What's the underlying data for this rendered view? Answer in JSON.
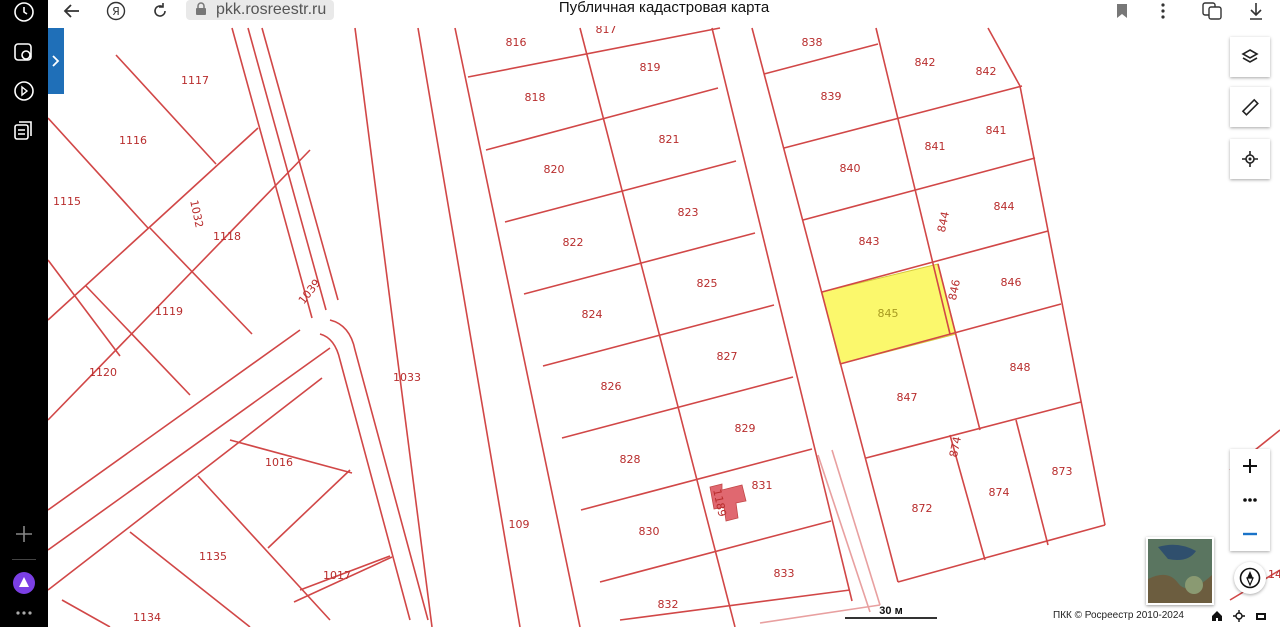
{
  "browser": {
    "url": "pkk.rosreestr.ru",
    "title": "Публичная кадастровая карта"
  },
  "sidebar_left": {
    "icons": [
      "clock-icon",
      "camera-icon",
      "play-icon",
      "collections-icon",
      "plus-icon",
      "alice-icon",
      "more-icon"
    ]
  },
  "map": {
    "highlight_color": "#fbf86c",
    "parcel_color": "#d14747",
    "label_color": "#b82d2d",
    "parcels": {
      "p816": "816",
      "p817": "817",
      "p818": "818",
      "p819": "819",
      "p820": "820",
      "p821": "821",
      "p822": "822",
      "p823": "823",
      "p824": "824",
      "p825": "825",
      "p826": "826",
      "p827": "827",
      "p828": "828",
      "p829": "829",
      "p830": "830",
      "p831": "831",
      "p832": "832",
      "p833": "833",
      "p838": "838",
      "p839": "839",
      "p840": "840",
      "p841a": "841",
      "p841b": "841",
      "p842a": "842",
      "p842b": "842",
      "p843": "843",
      "p844a": "844",
      "p844b": "844",
      "p845": "845",
      "p846a": "846",
      "p846b": "846",
      "p847": "847",
      "p848": "848",
      "p872": "872",
      "p873": "873",
      "p874a": "874",
      "p874b": "874",
      "p1017": "1017",
      "p1016": "1016",
      "p1032": "1032",
      "p1033": "1033",
      "p1039": "1039",
      "p109": "109",
      "p1115": "1115",
      "p1116": "1116",
      "p1117": "1117",
      "p1118": "1118",
      "p1119": "1119",
      "p1120": "1120",
      "p1134": "1134",
      "p1135": "1135",
      "p1189": "1189",
      "p14": "14"
    },
    "selected_parcel": "845"
  },
  "controls": {
    "layers": "layers-icon",
    "ruler": "ruler-icon",
    "locate": "locate-icon",
    "zoom_in": "+",
    "zoom_more": "•••",
    "zoom_out": "−"
  },
  "scale": {
    "label": "30 м"
  },
  "copyright": "ПКК © Росреестр 2010-2024"
}
